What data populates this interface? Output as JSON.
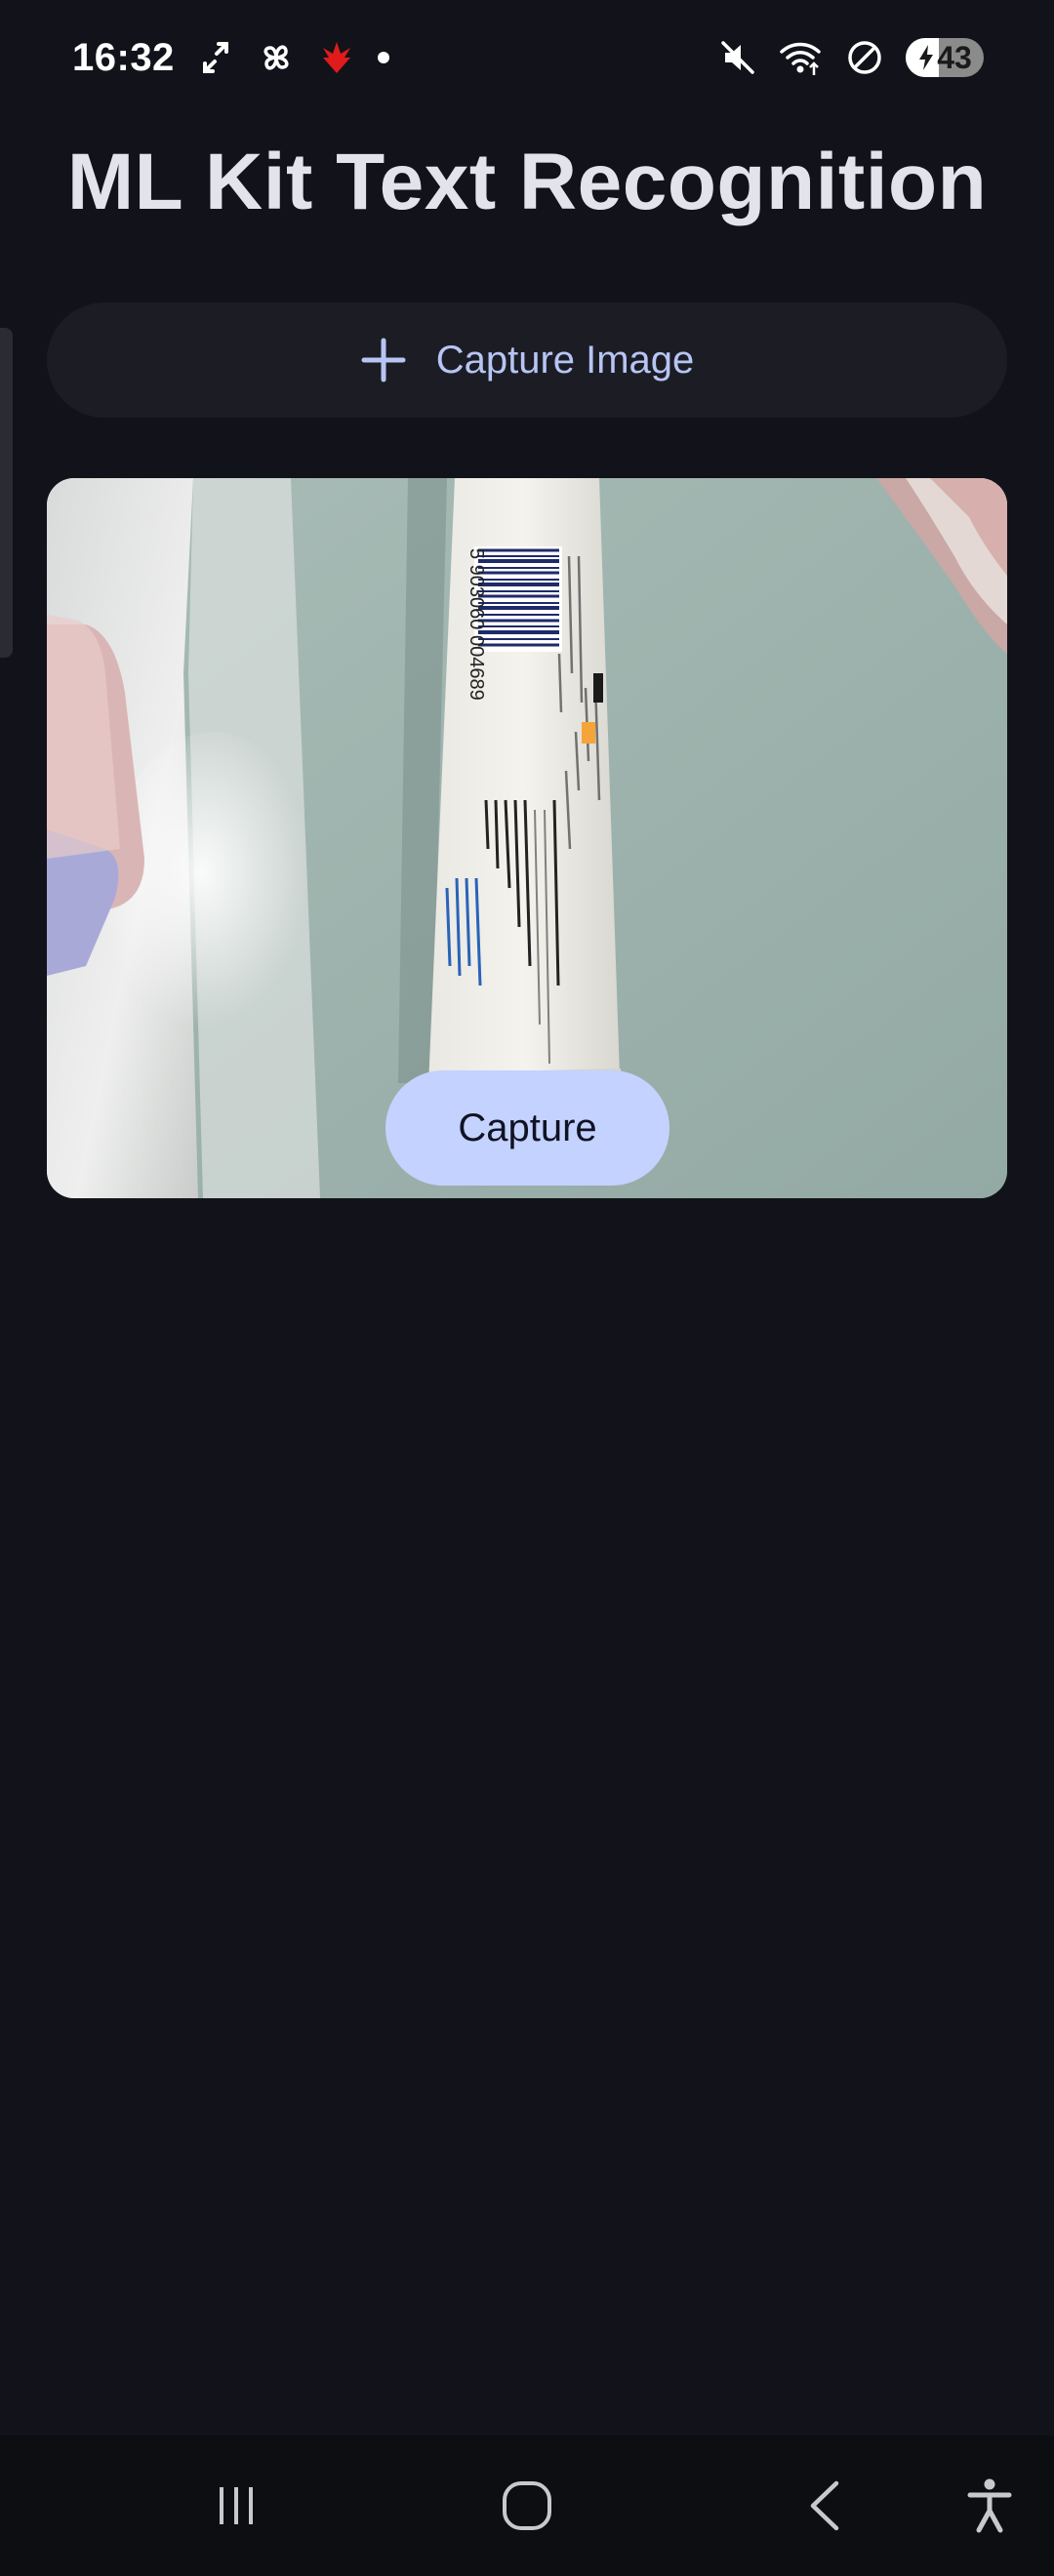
{
  "status_bar": {
    "time": "16:32",
    "battery_level": 43,
    "battery_text": "43",
    "icons_left": [
      "link-icon",
      "pinwheel-icon",
      "red-lotus-app-icon",
      "notification-dot"
    ],
    "icons_right": [
      "mute-icon",
      "wifi-icon",
      "do-not-disturb-icon",
      "battery-icon"
    ]
  },
  "header": {
    "title": "ML Kit Text Recognition"
  },
  "actions": {
    "capture_image_label": "Capture Image",
    "capture_image_icon": "plus-icon",
    "capture_label": "Capture"
  },
  "preview": {
    "barcode_text": "5 903060 004689"
  },
  "nav_bar": {
    "buttons": [
      "recent-apps-icon",
      "home-icon",
      "back-icon",
      "accessibility-icon"
    ]
  },
  "colors": {
    "background": "#12131a",
    "accent": "#c4d2ff",
    "accent_text": "#b7c5f5",
    "surface": "#1c1d24"
  }
}
